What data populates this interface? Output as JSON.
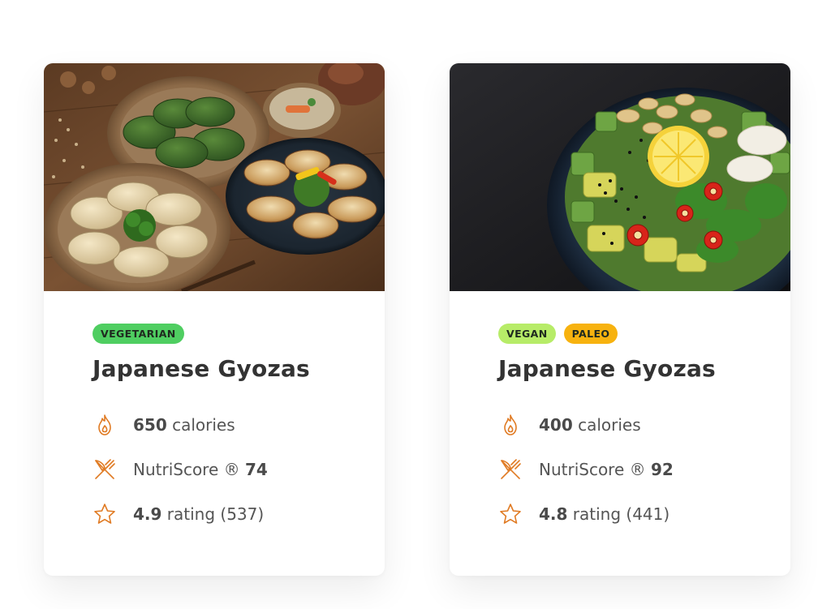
{
  "theme": {
    "icon_color": "#e07b24",
    "title_color": "#333333",
    "text_color": "#555555"
  },
  "cards": [
    {
      "image": {
        "label": "gyoza-photo",
        "dish": "dumplings"
      },
      "tags": [
        {
          "label": "VEGETARIAN",
          "color": "#4fce61"
        }
      ],
      "title": "Japanese Gyozas",
      "calories_value": "650",
      "calories_label": "calories",
      "nutriscore_label": "NutriScore ®",
      "nutriscore_value": "74",
      "rating_value": "4.9",
      "rating_label": "rating",
      "rating_count": "(537)"
    },
    {
      "image": {
        "label": "salad-bowl-photo",
        "dish": "poke-bowl"
      },
      "tags": [
        {
          "label": "VEGAN",
          "color": "#b7ec68"
        },
        {
          "label": "PALEO",
          "color": "#f7b20f"
        }
      ],
      "title": "Japanese Gyozas",
      "calories_value": "400",
      "calories_label": "calories",
      "nutriscore_label": "NutriScore ®",
      "nutriscore_value": "92",
      "rating_value": "4.8",
      "rating_label": "rating",
      "rating_count": "(441)"
    }
  ]
}
